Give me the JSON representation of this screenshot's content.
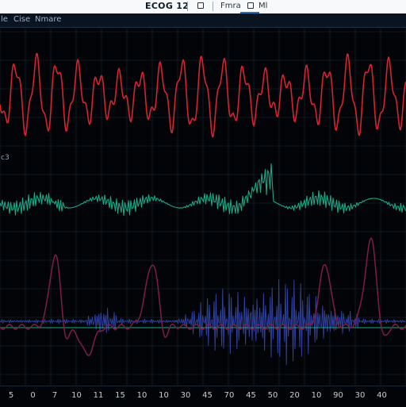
{
  "window": {
    "title": "ECOG 12",
    "tab_label": "Fmra",
    "tab2_label": "Ml"
  },
  "menu": {
    "items": [
      "le",
      "Cise",
      "Nmare"
    ]
  },
  "channels": [
    {
      "label": "",
      "color": "#d5232f"
    },
    {
      "label": "c3",
      "color": "#1aa885"
    },
    {
      "label": "",
      "color": "#2f3f9e"
    }
  ],
  "axis": {
    "ticks": [
      "5",
      "0",
      "7",
      "10",
      "11",
      "15",
      "10",
      "10",
      "30",
      "45",
      "70",
      "45",
      "50",
      "20",
      "10",
      "90",
      "30",
      "40"
    ]
  },
  "colors": {
    "background": "#020407",
    "grid": "#1b2a38",
    "red_trace": "#d5232f",
    "green_trace": "#1aa885",
    "blue_trace": "#2f3f9e",
    "maroon_trace": "#7e1d45"
  }
}
